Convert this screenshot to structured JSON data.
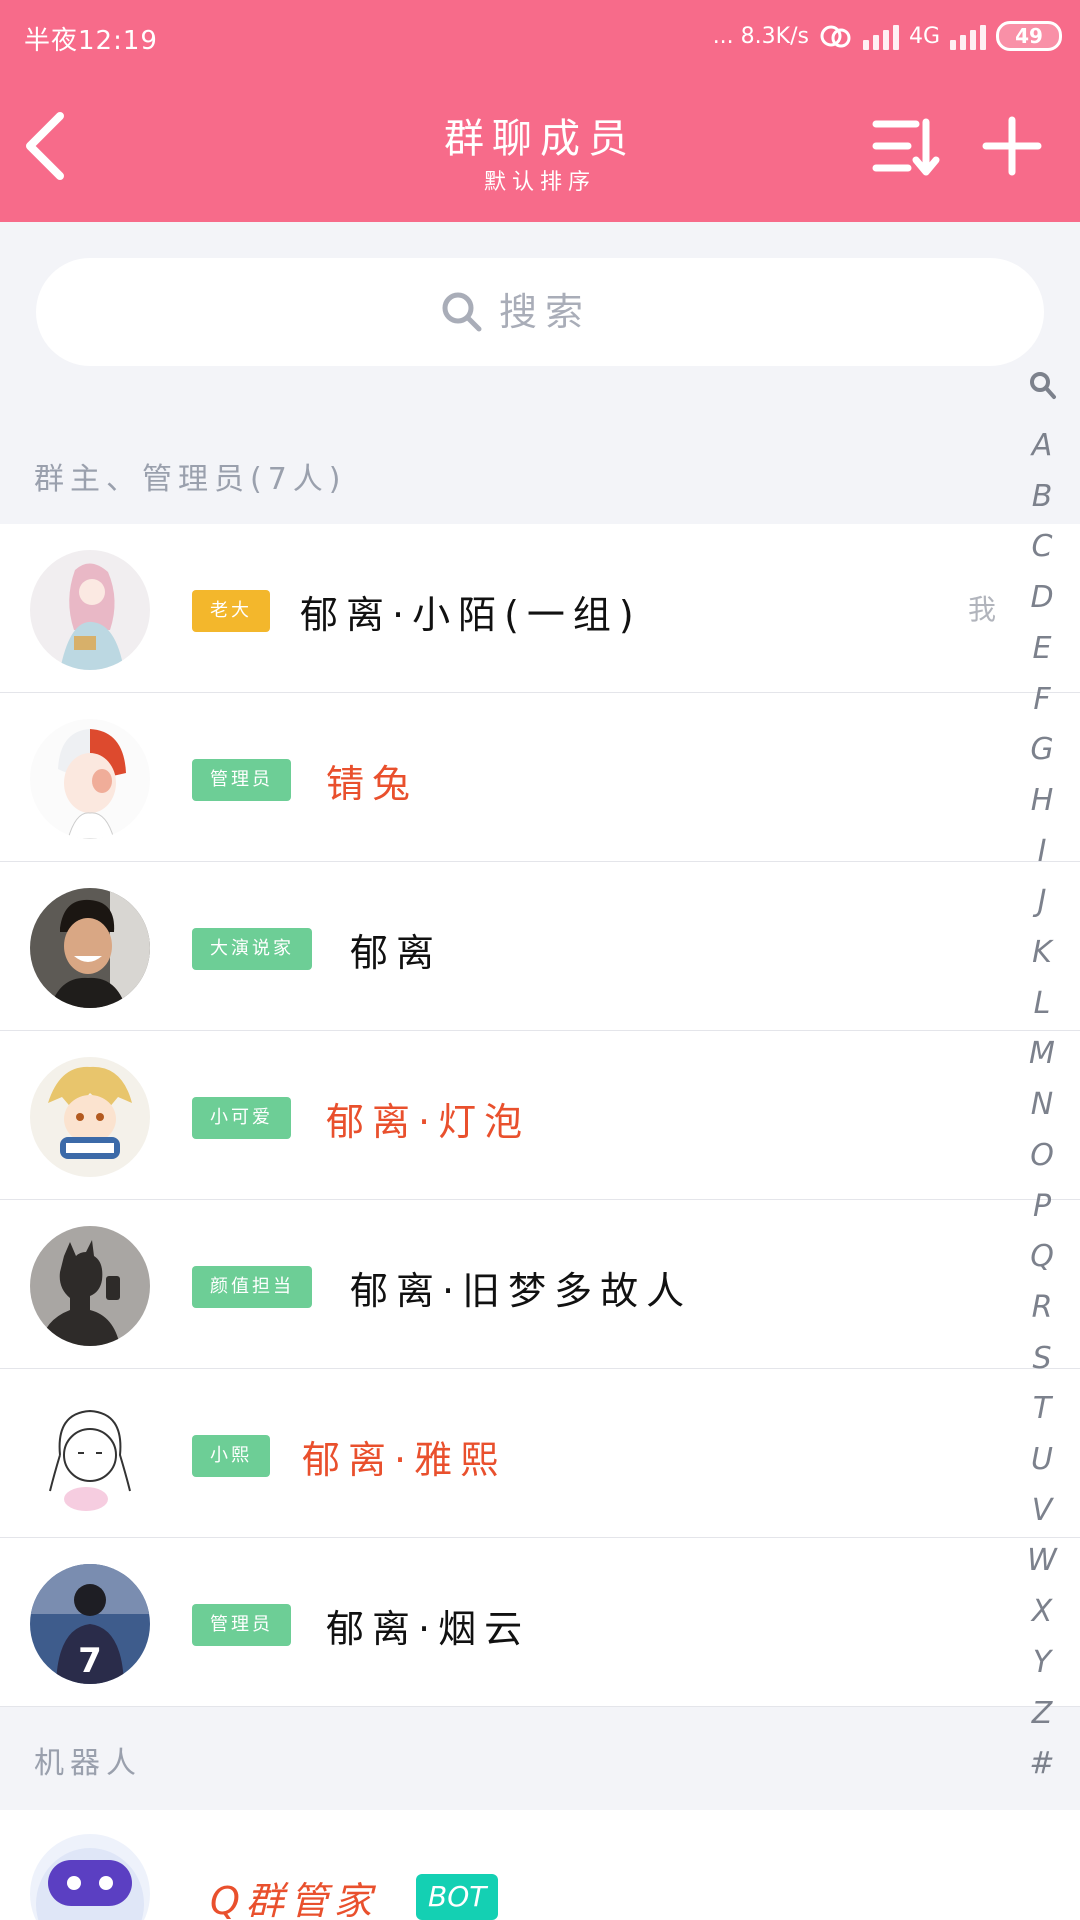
{
  "status_bar": {
    "time": "半夜12:19",
    "network_speed": "... 8.3K/s",
    "network_type": "4G",
    "battery": "49"
  },
  "header": {
    "title": "群聊成员",
    "subtitle": "默认排序",
    "background_color": "#f76b8a"
  },
  "search": {
    "placeholder": "搜索"
  },
  "sections": {
    "admins_title": "群主、管理员(7人)",
    "bots_title": "机器人"
  },
  "members": [
    {
      "badge": "老大",
      "badge_color": "#f3b72c",
      "name": "郁离·小陌(一组)",
      "name_color": "#111111",
      "self_tag": "我"
    },
    {
      "badge": "管理员",
      "badge_color": "#6dce96",
      "name": "锖兔",
      "name_color": "#e9502d",
      "self_tag": ""
    },
    {
      "badge": "大演说家",
      "badge_color": "#6dce96",
      "name": "郁离",
      "name_color": "#111111",
      "self_tag": ""
    },
    {
      "badge": "小可爱",
      "badge_color": "#6dce96",
      "name": "郁离·灯泡",
      "name_color": "#e9502d",
      "self_tag": ""
    },
    {
      "badge": "颜值担当",
      "badge_color": "#6dce96",
      "name": "郁离·旧梦多故人",
      "name_color": "#111111",
      "self_tag": ""
    },
    {
      "badge": "小熙",
      "badge_color": "#6dce96",
      "name": "郁离·雅熙",
      "name_color": "#e9502d",
      "self_tag": ""
    },
    {
      "badge": "管理员",
      "badge_color": "#6dce96",
      "name": "郁离·烟云",
      "name_color": "#111111",
      "self_tag": ""
    }
  ],
  "bots": [
    {
      "name": "Q群管家",
      "badge": "BOT"
    }
  ],
  "alpha_index": {
    "icon": "search-icon",
    "letters": [
      "A",
      "B",
      "C",
      "D",
      "E",
      "F",
      "G",
      "H",
      "I",
      "J",
      "K",
      "L",
      "M",
      "N",
      "O",
      "P",
      "Q",
      "R",
      "S",
      "T",
      "U",
      "V",
      "W",
      "X",
      "Y",
      "Z",
      "#"
    ]
  }
}
